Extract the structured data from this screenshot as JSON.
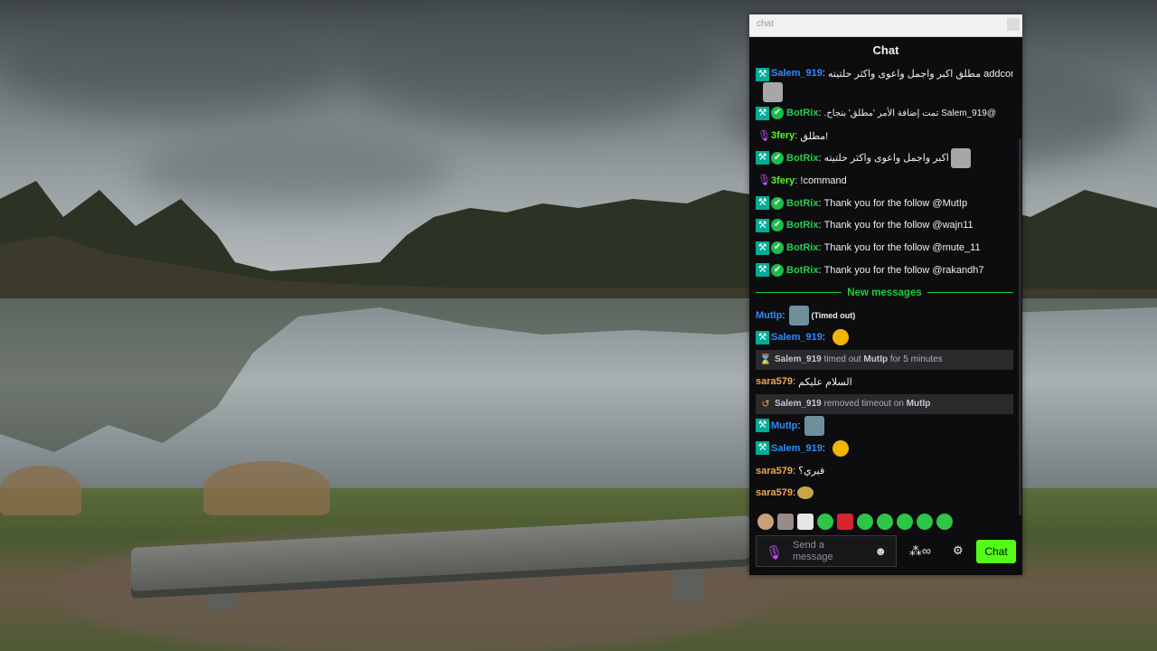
{
  "window": {
    "title": "chat"
  },
  "chat": {
    "header": "Chat"
  },
  "colors": {
    "accent": "#53fc18",
    "new_messages": "#1ecb3c",
    "blue_user": "#2d8cff",
    "bot_user": "#20d04a",
    "green_user": "#53fc18",
    "orange_user": "#f0a752"
  },
  "messages": [
    {
      "user": "Salem_919",
      "text": "!addcom مطلق اكبر واجمل واعوى واكثر حلتيته",
      "color": "#2d8cff"
    },
    {
      "user": "BotRix",
      "text": "@Salem_919 تمت إضافة الأمر 'مطلق' بنجاح.",
      "color": "#20d04a"
    },
    {
      "user": "3fery",
      "text": "!مطلق",
      "color": "#53fc18"
    },
    {
      "user": "BotRix",
      "text": "اكبر واجمل واعوى واكثر حلتيته",
      "color": "#20d04a"
    },
    {
      "user": "3fery",
      "text": "!command",
      "color": "#53fc18"
    },
    {
      "user": "BotRix",
      "text": "Thank you for the follow @MutIp",
      "color": "#20d04a"
    },
    {
      "user": "BotRix",
      "text": "Thank you for the follow @wajn11",
      "color": "#20d04a"
    },
    {
      "user": "BotRix",
      "text": "Thank you for the follow @mute_11",
      "color": "#20d04a"
    },
    {
      "user": "BotRix",
      "text": "Thank you for the follow @rakandh7",
      "color": "#20d04a"
    }
  ],
  "new_messages_label": "New messages",
  "new_messages_list": [
    {
      "user": "MutIp",
      "text": "(Timed out)",
      "color": "#2d8cff"
    },
    {
      "user": "Salem_919",
      "text": "",
      "color": "#2d8cff"
    },
    {
      "system": true,
      "icon": "hourglass-icon",
      "user": "Salem_919",
      "action": "timed out",
      "target": "MutIp",
      "suffix": "for 5 minutes"
    },
    {
      "user": "sara579",
      "text": "السلام عليكم",
      "color": "#f0a752"
    },
    {
      "system": true,
      "icon": "undo-icon",
      "user": "Salem_919",
      "action": "removed timeout on",
      "target": "MutIp",
      "suffix": ""
    },
    {
      "user": "MutIp",
      "text": "",
      "color": "#2d8cff"
    },
    {
      "user": "Salem_919",
      "text": "",
      "color": "#2d8cff"
    },
    {
      "user": "sara579",
      "text": "فيري؟",
      "color": "#f0a752"
    },
    {
      "user": "sara579",
      "text": "",
      "color": "#f0a752"
    }
  ],
  "input": {
    "placeholder": "Send a message",
    "send_label": "Chat"
  }
}
